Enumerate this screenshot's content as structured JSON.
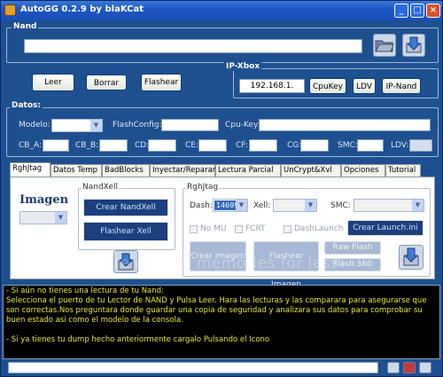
{
  "window": {
    "title": "AutoGG 0.2.9 by blaKCat"
  },
  "nand": {
    "group_label": "Nand",
    "path_value": ""
  },
  "buttons": {
    "leer": "Leer",
    "borrar": "Borrar",
    "flashear": "Flashear"
  },
  "ipxbox": {
    "group_label": "IP-Xbox",
    "ip_value": "192.168.1.",
    "cpukey": "CpuKey",
    "ldv": "LDV",
    "ipnand": "IP-Nand"
  },
  "datos": {
    "group_label": "Datos:",
    "modelo": "Modelo:",
    "flashconfig": "FlashConfig:",
    "cpukey": "Cpu-Key:",
    "cba": "CB_A:",
    "cbb": "CB_B:",
    "cd": "CD:",
    "ce": "CE:",
    "cf": "CF:",
    "cg": "CG:",
    "smc": "SMC:",
    "ldv": "LDV:"
  },
  "tabs": [
    "RghJtag",
    "Datos Temp",
    "BadBlocks",
    "Inyectar/Reparar",
    "Lectura Parcial",
    "UnCrypt&Xvl",
    "Opciones",
    "Tutorial"
  ],
  "panel": {
    "imagen": "Imagen",
    "nandxell_label": "NandXell",
    "crear_nandxell": "Crear NandXell",
    "flashear_xell": "Flashear Xell",
    "rghjtag_label": "RghJtag",
    "dash_label": "Dash:",
    "dash_value": "14699",
    "xell_label": "Xell:",
    "smc_label": "SMC:",
    "no_mu": "No MU",
    "fcrt": "FCRT",
    "dashlaunch": "DashLaunch",
    "crear_launch": "Crear Launch.ini",
    "crear_imagen": "Crear Imagen",
    "flashear_imagen": "Flashear Imagen",
    "raw_flash": "Raw Flash",
    "flash_360": "Flash 360"
  },
  "watermark": "Protect more of your memories for less!",
  "log_lines": [
    "- Si aún no tienes una lectura de tu Nand:",
    "Selecciona el puerto de tu Lector de NAND y Pulsa Leer. Hara las lecturas y las comparara para asegurarse que",
    "son correctas.Nos preguntara donde guardar una copia de seguridad y analizara sus datos para comprobar su",
    "buen estado asi como el modelo de la consola.",
    "",
    "- Si ya tienes tu dump hecho anteriormente cargalo Pulsando el Icono"
  ],
  "colors": {
    "window_bg": "#1e4f8f",
    "log_text": "#e8e83a",
    "log_bg": "#000000"
  }
}
